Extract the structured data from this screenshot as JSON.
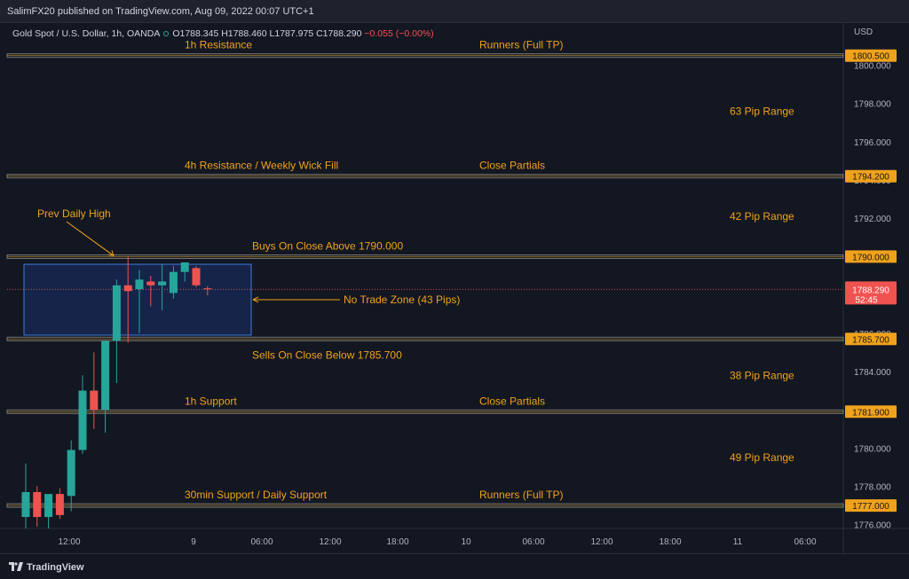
{
  "header": {
    "published": "SalimFX20 published on TradingView.com, Aug 09, 2022 00:07 UTC+1"
  },
  "legend": {
    "symbol": "Gold Spot / U.S. Dollar, 1h, OANDA",
    "open": "O1788.345",
    "high": "H1788.460",
    "low": "L1787.975",
    "close": "C1788.290",
    "change": "−0.055 (−0.00%)"
  },
  "currency": "USD",
  "footer": {
    "brand": "TradingView"
  },
  "colors": {
    "background": "#131722",
    "up": "#26a69a",
    "down": "#ef5350",
    "annotation": "#f0a21c",
    "level_line": "#8d8a80",
    "zone": "#2962ff"
  },
  "chart_data": {
    "type": "candlestick",
    "ylim": [
      1775.8,
      1802.2
    ],
    "x_labels": [
      "12:00",
      "9",
      "06:00",
      "12:00",
      "18:00",
      "10",
      "06:00",
      "12:00",
      "18:00",
      "11",
      "06:00"
    ],
    "y_ticks": [
      "1776.000",
      "1778.000",
      "1780.000",
      "1782.000",
      "1784.000",
      "1786.000",
      "1788.000",
      "1790.000",
      "1792.000",
      "1794.000",
      "1796.000",
      "1798.000",
      "1800.000"
    ],
    "y_tick_values": [
      1776,
      1778,
      1780,
      1782,
      1784,
      1786,
      1788,
      1790,
      1792,
      1794,
      1796,
      1798,
      1800
    ],
    "price_levels": [
      {
        "label": "1800.500",
        "value": 1800.5
      },
      {
        "label": "1794.200",
        "value": 1794.2
      },
      {
        "label": "1790.000",
        "value": 1790.0
      },
      {
        "label": "1785.700",
        "value": 1785.7
      },
      {
        "label": "1781.900",
        "value": 1781.9
      },
      {
        "label": "1777.000",
        "value": 1777.0
      }
    ],
    "last_price": {
      "label": "1788.290",
      "countdown": "52:45",
      "value": 1788.29
    },
    "candles": [
      {
        "o": 1776.4,
        "h": 1779.2,
        "l": 1775.8,
        "c": 1777.7
      },
      {
        "o": 1777.7,
        "h": 1778.0,
        "l": 1775.9,
        "c": 1776.4
      },
      {
        "o": 1776.4,
        "h": 1777.5,
        "l": 1775.8,
        "c": 1777.6
      },
      {
        "o": 1777.6,
        "h": 1777.9,
        "l": 1776.3,
        "c": 1776.5
      },
      {
        "o": 1777.5,
        "h": 1780.4,
        "l": 1776.7,
        "c": 1779.9
      },
      {
        "o": 1779.9,
        "h": 1783.8,
        "l": 1779.7,
        "c": 1783.0
      },
      {
        "o": 1783.0,
        "h": 1785.0,
        "l": 1781.0,
        "c": 1782.0
      },
      {
        "o": 1782.0,
        "h": 1785.5,
        "l": 1780.8,
        "c": 1785.6
      },
      {
        "o": 1785.6,
        "h": 1788.8,
        "l": 1783.4,
        "c": 1788.5
      },
      {
        "o": 1788.5,
        "h": 1790.0,
        "l": 1785.5,
        "c": 1788.2
      },
      {
        "o": 1788.3,
        "h": 1789.3,
        "l": 1786.0,
        "c": 1788.8
      },
      {
        "o": 1788.7,
        "h": 1789.0,
        "l": 1787.4,
        "c": 1788.5
      },
      {
        "o": 1788.5,
        "h": 1789.6,
        "l": 1787.2,
        "c": 1788.7
      },
      {
        "o": 1788.1,
        "h": 1789.5,
        "l": 1787.8,
        "c": 1789.2
      },
      {
        "o": 1789.2,
        "h": 1789.6,
        "l": 1788.7,
        "c": 1789.7
      },
      {
        "o": 1789.4,
        "h": 1789.5,
        "l": 1788.4,
        "c": 1788.5
      },
      {
        "o": 1788.345,
        "h": 1788.46,
        "l": 1787.975,
        "c": 1788.29
      }
    ],
    "zone": {
      "label": "No Trade Zone (43 Pips)",
      "top": 1789.6,
      "bottom": 1785.9
    },
    "annotations": [
      {
        "text": "1h Resistance",
        "price": 1800.5,
        "pos": "left"
      },
      {
        "text": "Runners (Full TP)",
        "price": 1800.5,
        "pos": "right"
      },
      {
        "text": "4h Resistance / Weekly Wick Fill",
        "price": 1794.2,
        "pos": "left"
      },
      {
        "text": "Close Partials",
        "price": 1794.2,
        "pos": "right"
      },
      {
        "text": "Buys On Close Above 1790.000",
        "price": 1790.0,
        "pos": "mid"
      },
      {
        "text": "Sells On Close Below 1785.700",
        "price": 1785.7,
        "pos": "mid-below"
      },
      {
        "text": "1h Support",
        "price": 1781.9,
        "pos": "left"
      },
      {
        "text": "Close Partials",
        "price": 1781.9,
        "pos": "right"
      },
      {
        "text": "30min Support / Daily Support",
        "price": 1777.0,
        "pos": "left"
      },
      {
        "text": "Runners (Full TP)",
        "price": 1777.0,
        "pos": "right"
      }
    ],
    "ranges": [
      {
        "text": "63 Pip Range",
        "price": 1797.6
      },
      {
        "text": "42 Pip Range",
        "price": 1792.1
      },
      {
        "text": "38 Pip Range",
        "price": 1783.8
      },
      {
        "text": "49 Pip Range",
        "price": 1779.5
      }
    ],
    "callout": {
      "text": "Prev Daily High"
    }
  }
}
